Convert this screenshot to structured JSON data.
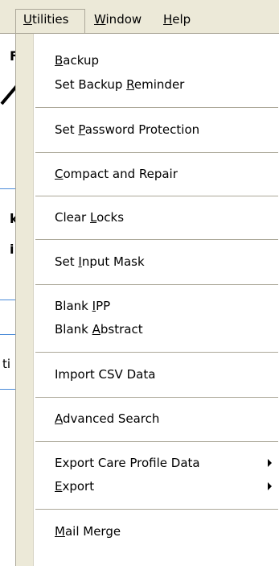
{
  "menubar": {
    "utilities": {
      "u": "U",
      "rest": "tilities"
    },
    "window": {
      "u": "W",
      "rest": "indow"
    },
    "help": {
      "u": "H",
      "rest": "elp"
    }
  },
  "background": {
    "letters": [
      "F",
      "k",
      "i",
      "ti"
    ]
  },
  "menu": {
    "backup": {
      "pre": "",
      "u": "B",
      "post": "ackup"
    },
    "set_backup_reminder": {
      "pre": "Set Backup ",
      "u": "R",
      "post": "eminder"
    },
    "set_password_protection": {
      "pre": "Set ",
      "u": "P",
      "post": "assword Protection"
    },
    "compact_and_repair": {
      "pre": "",
      "u": "C",
      "post": "ompact and Repair"
    },
    "clear_locks": {
      "pre": "Clear ",
      "u": "L",
      "post": "ocks"
    },
    "set_input_mask": {
      "pre": "Set ",
      "u": "I",
      "post": "nput Mask"
    },
    "blank_ipp": {
      "pre": "Blank ",
      "u": "I",
      "post": "PP"
    },
    "blank_abstract": {
      "pre": "Blank ",
      "u": "A",
      "post": "bstract"
    },
    "import_csv_data": {
      "label": "Import CSV Data"
    },
    "advanced_search": {
      "pre": "",
      "u": "A",
      "post": "dvanced Search"
    },
    "export_care_profile_data": {
      "label": "Export Care Profile Data"
    },
    "export": {
      "pre": "",
      "u": "E",
      "post": "xport"
    },
    "mail_merge": {
      "pre": "",
      "u": "M",
      "post": "ail Merge"
    }
  }
}
